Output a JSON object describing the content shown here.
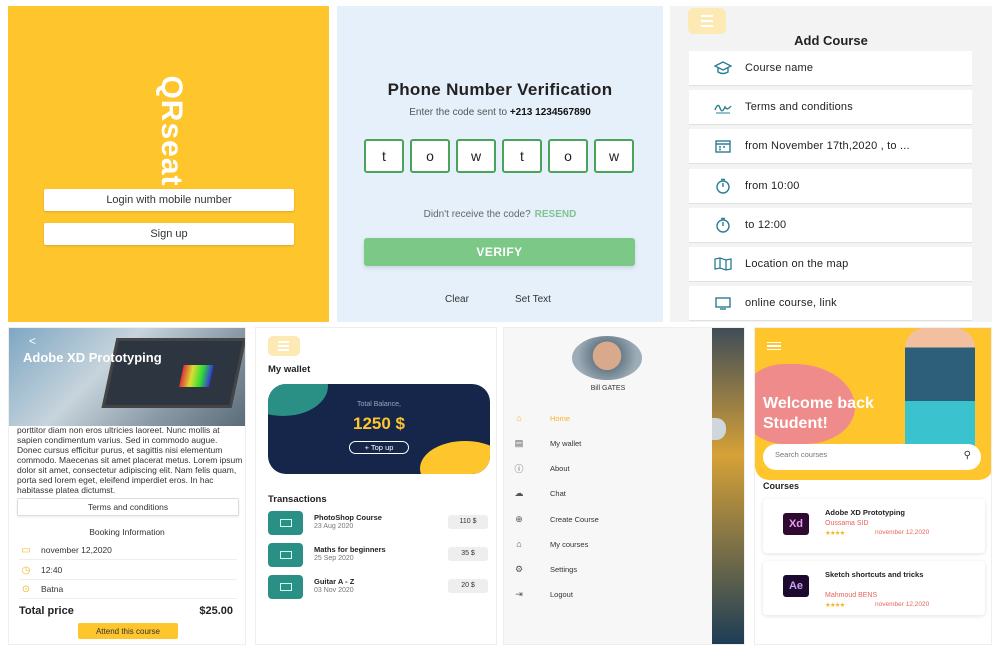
{
  "qrseat": {
    "logo": "QRseat",
    "login_btn": "Login with mobile number",
    "signup_btn": "Sign up"
  },
  "verify": {
    "title": "Phone Number Verification",
    "subtitle": "Enter the code sent to",
    "phone": "+213 1234567890",
    "code": [
      "t",
      "o",
      "w",
      "t",
      "o",
      "w"
    ],
    "no_code": "Didn't receive the code?",
    "resend": "RESEND",
    "verify_btn": "VERIFY",
    "clear": "Clear",
    "set_text": "Set Text"
  },
  "add_course": {
    "title": "Add Course",
    "rows": [
      {
        "icon": "graduation-cap-icon",
        "label": "Course name"
      },
      {
        "icon": "signature-icon",
        "label": "Terms and conditions"
      },
      {
        "icon": "calendar-icon",
        "label": "from November 17th,2020 , to ..."
      },
      {
        "icon": "timer-icon",
        "label": "from 10:00"
      },
      {
        "icon": "timer-icon",
        "label": "to 12:00"
      },
      {
        "icon": "map-icon",
        "label": "Location on the map"
      },
      {
        "icon": "monitor-icon",
        "label": "online course, link"
      }
    ]
  },
  "detail": {
    "back": "<",
    "title": "Adobe XD Prototyping",
    "desc": "porttitor diam non eros ultricies laoreet. Nunc mollis at sapien condimentum varius. Sed in commodo augue. Donec cursus efficitur purus, et sagittis nisi elementum commodo. Maecenas sit amet placerat metus. Lorem ipsum dolor sit amet, consectetur adipiscing elit. Nam felis quam, porta sed lorem eget, eleifend imperdiet eros. In hac habitasse platea dictumst.",
    "terms_btn": "Terms and conditions",
    "booking_title": "Booking Information",
    "date": "november 12,2020",
    "time": "12:40",
    "place": "Batna",
    "total_label": "Total price",
    "total_value": "$25.00",
    "attend_btn": "Attend this course"
  },
  "wallet": {
    "title": "My wallet",
    "balance_label": "Total Balance,",
    "balance": "1250 $",
    "topup": "+ Top up",
    "tx_title": "Transactions",
    "transactions": [
      {
        "name": "PhotoShop Course",
        "date": "23 Aug 2020",
        "amount": "110 $"
      },
      {
        "name": "Maths for beginners",
        "date": "25 Sep 2020",
        "amount": "35 $"
      },
      {
        "name": "Guitar A - Z",
        "date": "03 Nov 2020",
        "amount": "20 $"
      }
    ]
  },
  "drawer": {
    "user": "Bill GATES",
    "items": [
      {
        "icon": "home-icon",
        "label": "Home",
        "active": true
      },
      {
        "icon": "wallet-icon",
        "label": "My wallet"
      },
      {
        "icon": "info-icon",
        "label": "About"
      },
      {
        "icon": "chat-icon",
        "label": "Chat"
      },
      {
        "icon": "plus-circle-icon",
        "label": "Create Course"
      },
      {
        "icon": "graduation-cap-icon",
        "label": "My courses"
      },
      {
        "icon": "settings-icon",
        "label": "Settings"
      },
      {
        "icon": "logout-icon",
        "label": "Logout"
      }
    ]
  },
  "welcome": {
    "headline": "Welcome back Student!",
    "search_placeholder": "Search courses",
    "courses_title": "Courses",
    "courses": [
      {
        "logo": "Xd",
        "name": "Adobe XD Prototyping",
        "author": "Oussama SID",
        "stars": "★★★★",
        "date": "november 12,2020"
      },
      {
        "logo": "Ae",
        "name": "Sketch shortcuts and tricks",
        "author": "Mahmoud BENS",
        "stars": "★★★★",
        "date": "november 12,2020"
      }
    ]
  },
  "colors": {
    "yellow": "#fec52d",
    "green": "#7cc987",
    "teal": "#2a8f85",
    "navy": "#15264a",
    "coral": "#e5655c"
  }
}
